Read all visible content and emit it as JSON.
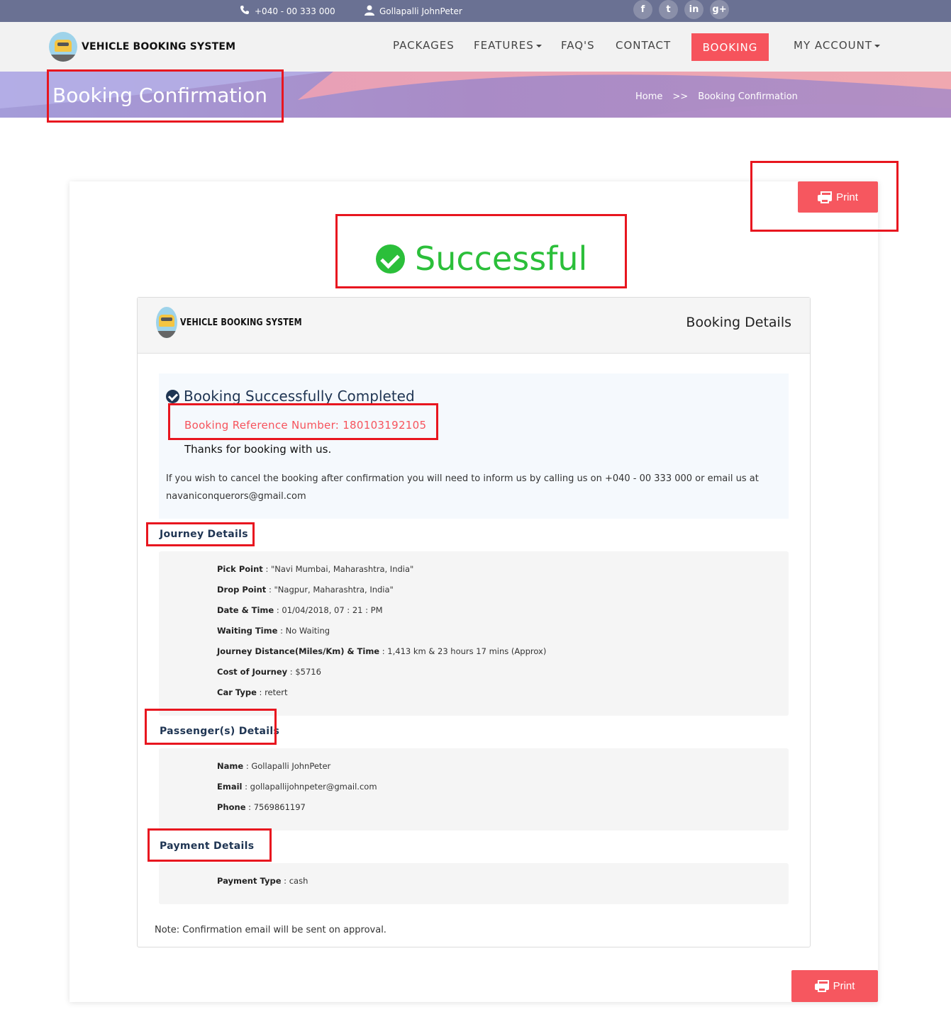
{
  "topbar": {
    "phone": "+040 - 00 333 000",
    "user": "Gollapalli JohnPeter",
    "social": [
      "f",
      "t",
      "in",
      "g+"
    ]
  },
  "nav": {
    "brand": "VEHICLE BOOKING SYSTEM",
    "items": [
      "PACKAGES",
      "FEATURES",
      "FAQ'S",
      "CONTACT",
      "BOOKING",
      "MY ACCOUNT"
    ]
  },
  "banner": {
    "title": "Booking Confirmation",
    "breadcrumb": [
      "Home",
      ">>",
      "Booking Confirmation"
    ]
  },
  "print_label": "Print",
  "status": "Successful",
  "details": {
    "brand": "VEHICLE BOOKING SYSTEM",
    "title": "Booking Details",
    "success_heading": "Booking Successfully Completed",
    "reference": "Booking Reference Number: 180103192105",
    "thanks": "Thanks for booking with us.",
    "cancel_info": "If you wish to cancel the booking after confirmation you will need to inform us by calling us on +040 - 00 333 000 or email us at navaniconquerors@gmail.com",
    "journey": {
      "title": "Journey Details",
      "rows": [
        {
          "label": "Pick Point",
          "value": "\"Navi Mumbai, Maharashtra, India\""
        },
        {
          "label": "Drop Point",
          "value": "\"Nagpur, Maharashtra, India\""
        },
        {
          "label": "Date & Time",
          "value": "01/04/2018, 07 : 21 : PM"
        },
        {
          "label": "Waiting Time",
          "value": "No Waiting"
        },
        {
          "label": "Journey Distance(Miles/Km) & Time",
          "value": "1,413 km & 23 hours 17 mins (Approx)"
        },
        {
          "label": "Cost of Journey",
          "value": "$5716"
        },
        {
          "label": "Car Type",
          "value": "retert"
        }
      ]
    },
    "passenger": {
      "title": "Passenger(s) Details",
      "rows": [
        {
          "label": "Name",
          "value": "Gollapalli JohnPeter"
        },
        {
          "label": "Email",
          "value": "gollapallijohnpeter@gmail.com"
        },
        {
          "label": "Phone",
          "value": "7569861197"
        }
      ]
    },
    "payment": {
      "title": "Payment Details",
      "rows": [
        {
          "label": "Payment Type",
          "value": "cash"
        }
      ]
    },
    "note": "Note: Confirmation email will be sent on approval."
  },
  "colors": {
    "accent": "#f6535c",
    "success": "#2bbf3a",
    "topbar": "#6a7193",
    "heading": "#1f3553",
    "annotation": "#e8161f"
  }
}
